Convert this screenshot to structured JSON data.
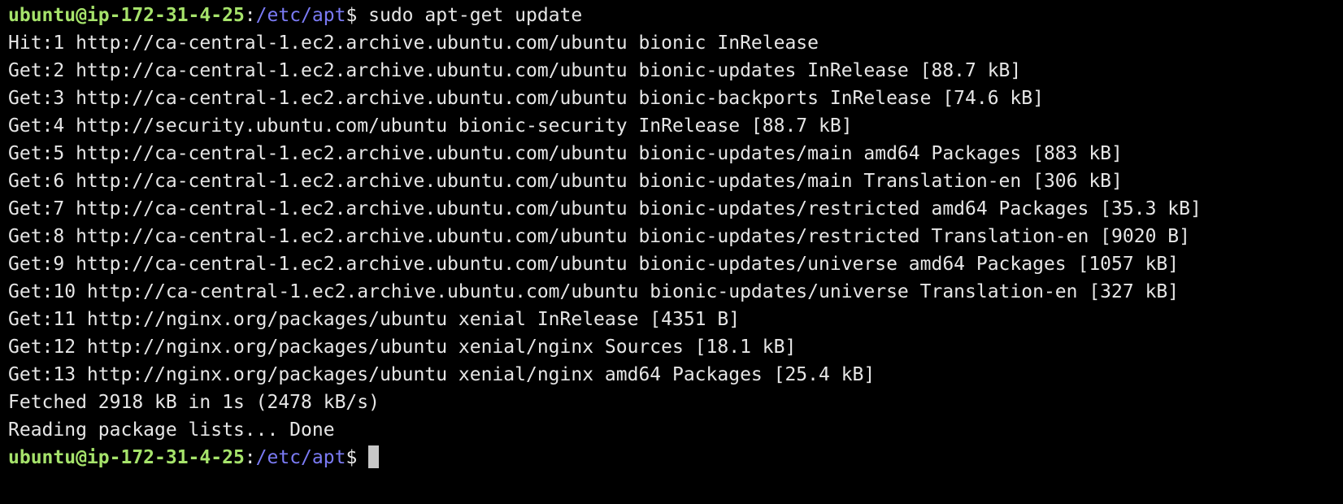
{
  "prompt": {
    "user_host": "ubuntu@ip-172-31-4-25",
    "separator": ":",
    "path": "/etc/apt",
    "dollar": "$"
  },
  "command": " sudo apt-get update",
  "output_lines": [
    "Hit:1 http://ca-central-1.ec2.archive.ubuntu.com/ubuntu bionic InRelease",
    "Get:2 http://ca-central-1.ec2.archive.ubuntu.com/ubuntu bionic-updates InRelease [88.7 kB]",
    "Get:3 http://ca-central-1.ec2.archive.ubuntu.com/ubuntu bionic-backports InRelease [74.6 kB]",
    "Get:4 http://security.ubuntu.com/ubuntu bionic-security InRelease [88.7 kB]",
    "Get:5 http://ca-central-1.ec2.archive.ubuntu.com/ubuntu bionic-updates/main amd64 Packages [883 kB]",
    "Get:6 http://ca-central-1.ec2.archive.ubuntu.com/ubuntu bionic-updates/main Translation-en [306 kB]",
    "Get:7 http://ca-central-1.ec2.archive.ubuntu.com/ubuntu bionic-updates/restricted amd64 Packages [35.3 kB]",
    "Get:8 http://ca-central-1.ec2.archive.ubuntu.com/ubuntu bionic-updates/restricted Translation-en [9020 B]",
    "Get:9 http://ca-central-1.ec2.archive.ubuntu.com/ubuntu bionic-updates/universe amd64 Packages [1057 kB]",
    "Get:10 http://ca-central-1.ec2.archive.ubuntu.com/ubuntu bionic-updates/universe Translation-en [327 kB]",
    "Get:11 http://nginx.org/packages/ubuntu xenial InRelease [4351 B]",
    "Get:12 http://nginx.org/packages/ubuntu xenial/nginx Sources [18.1 kB]",
    "Get:13 http://nginx.org/packages/ubuntu xenial/nginx amd64 Packages [25.4 kB]",
    "Fetched 2918 kB in 1s (2478 kB/s)",
    "Reading package lists... Done"
  ],
  "colors": {
    "background": "#000000",
    "text": "#e6e6e6",
    "prompt_user": "#a6e36b",
    "prompt_path": "#7b7bf5",
    "cursor": "#c8c8c8"
  }
}
